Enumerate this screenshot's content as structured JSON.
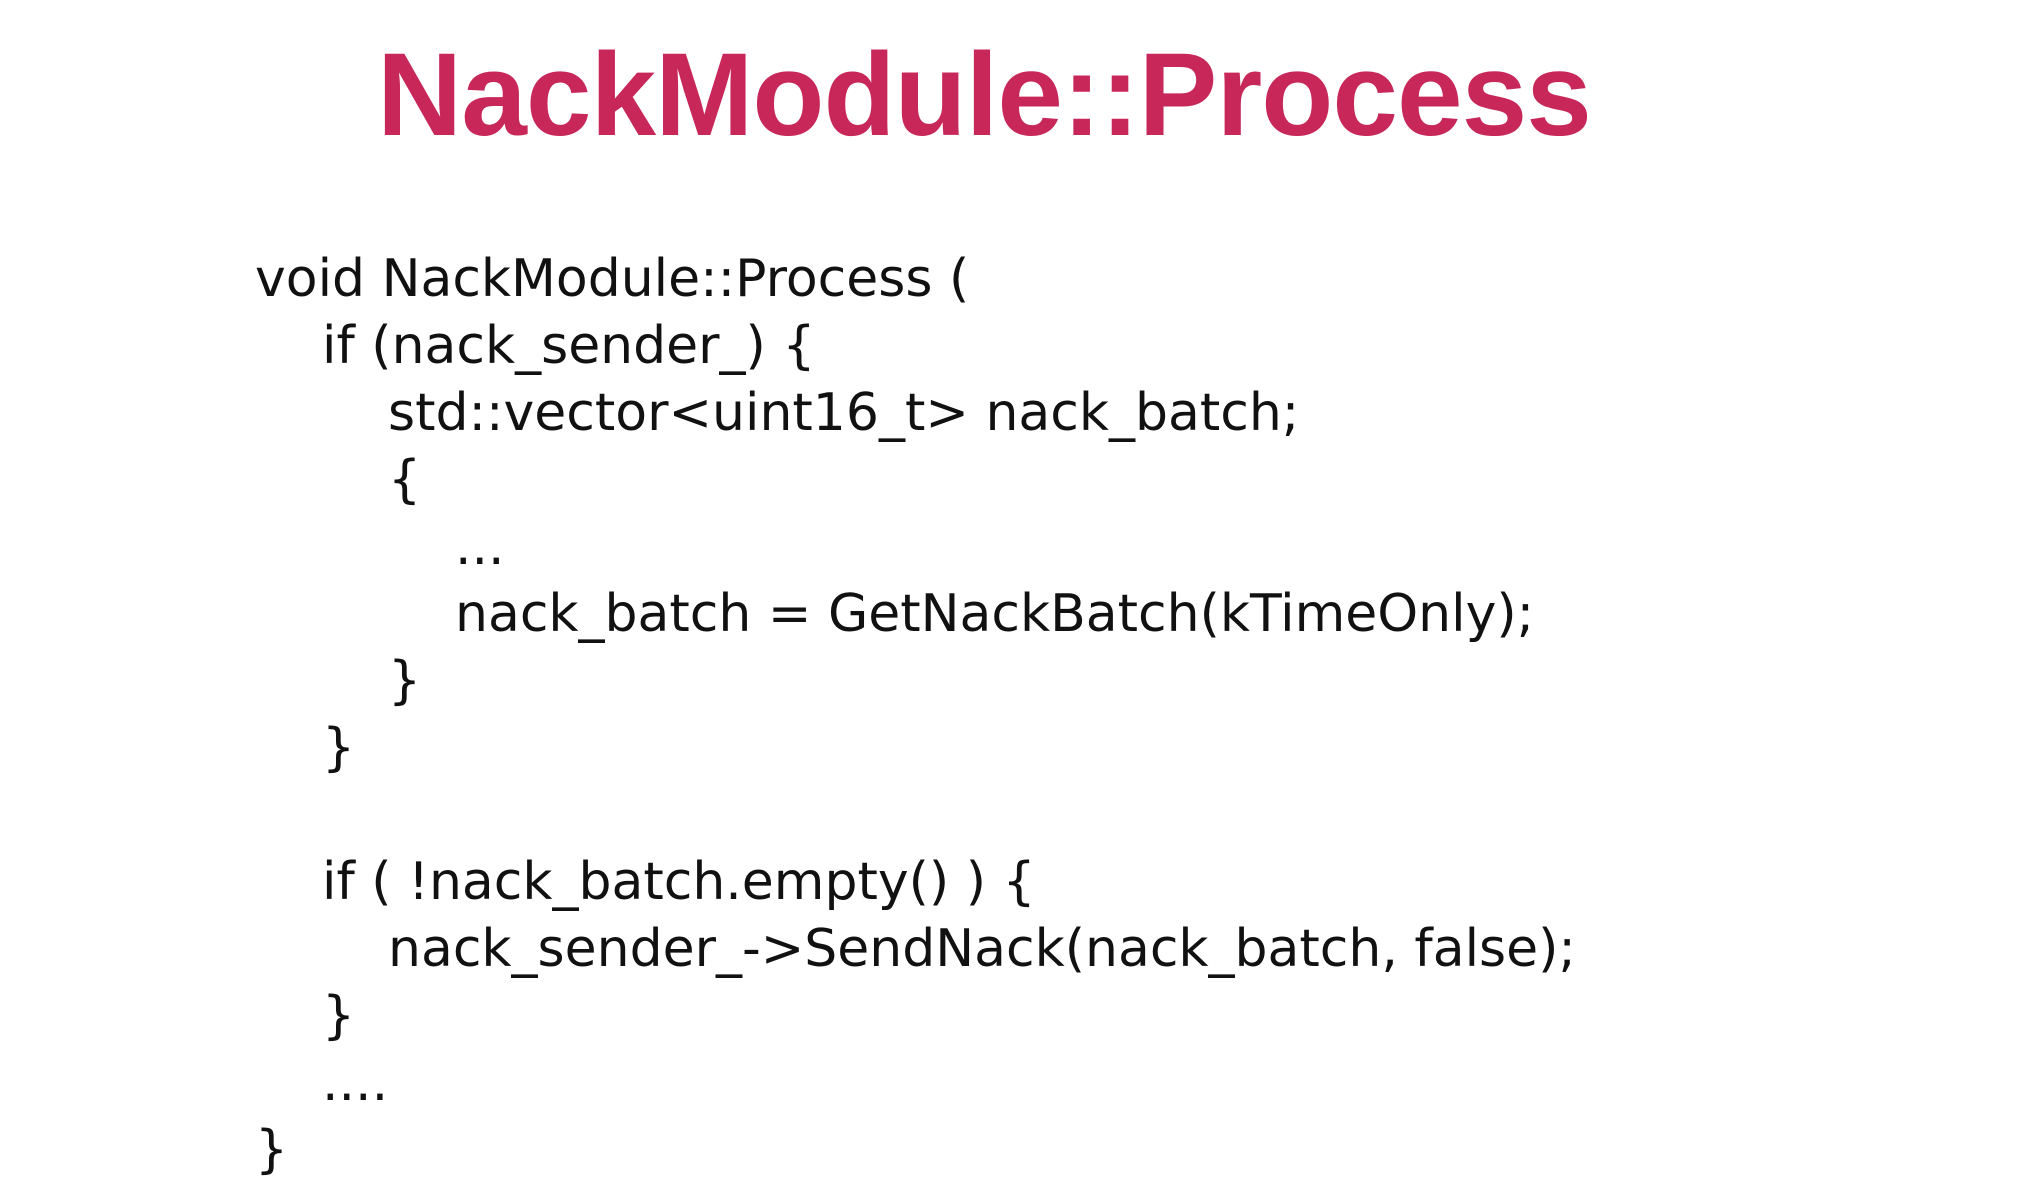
{
  "slide": {
    "title": "NackModule::Process",
    "code_lines": [
      {
        "indent": 0,
        "text": "void NackModule::Process ("
      },
      {
        "indent": 1,
        "text": "if (nack_sender_) {"
      },
      {
        "indent": 2,
        "text": "std::vector<uint16_t> nack_batch;"
      },
      {
        "indent": 2,
        "text": "{"
      },
      {
        "indent": 3,
        "text": "..."
      },
      {
        "indent": 3,
        "text": "nack_batch = GetNackBatch(kTimeOnly);"
      },
      {
        "indent": 2,
        "text": "}"
      },
      {
        "indent": 1,
        "text": "}"
      },
      {
        "indent": 0,
        "text": ""
      },
      {
        "indent": 1,
        "text": "if ( !nack_batch.empty() ) {"
      },
      {
        "indent": 2,
        "text": "nack_sender_->SendNack(nack_batch, false);"
      },
      {
        "indent": 1,
        "text": "}"
      },
      {
        "indent": 1,
        "text": "...."
      },
      {
        "indent": 0,
        "text": "}"
      }
    ]
  },
  "colors": {
    "title": "#c8275a",
    "code_text": "#111111",
    "background": "#ffffff"
  }
}
